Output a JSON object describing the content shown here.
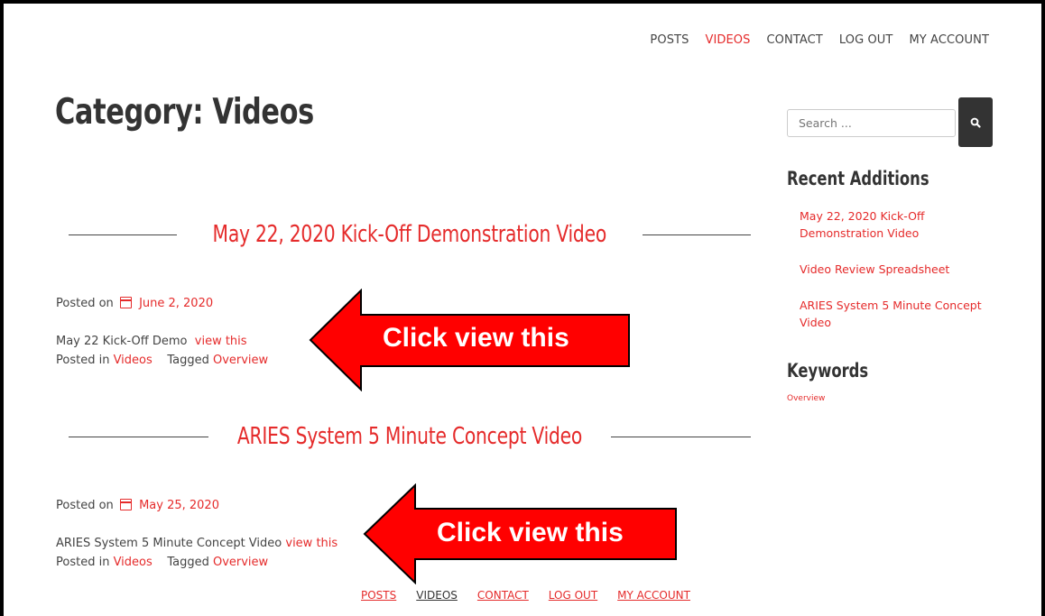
{
  "nav": {
    "items": [
      {
        "label": "POSTS"
      },
      {
        "label": "VIDEOS"
      },
      {
        "label": "CONTACT"
      },
      {
        "label": "LOG OUT"
      },
      {
        "label": "MY ACCOUNT"
      }
    ],
    "active": "VIDEOS"
  },
  "page_title": "Category: Videos",
  "posts": [
    {
      "title": "May 22, 2020 Kick-Off Demonstration Video",
      "posted_on_label": "Posted on",
      "date": "June 2, 2020",
      "excerpt": "May 22 Kick-Off Demo",
      "view_link": "view this",
      "posted_in_label": "Posted in",
      "category": "Videos",
      "tagged_label": "Tagged",
      "tag": "Overview"
    },
    {
      "title": "ARIES System 5 Minute Concept Video",
      "posted_on_label": "Posted on",
      "date": "May 25, 2020",
      "excerpt": "ARIES System 5 Minute Concept Video",
      "view_link": "view this",
      "posted_in_label": "Posted in",
      "category": "Videos",
      "tagged_label": "Tagged",
      "tag": "Overview"
    }
  ],
  "annotations": [
    {
      "label": "Click view this"
    },
    {
      "label": "Click view this"
    }
  ],
  "sidebar": {
    "search_placeholder": "Search ...",
    "search_icon": "search-icon",
    "recent_heading": "Recent Additions",
    "recent": [
      {
        "label": "May 22, 2020 Kick-Off Demonstration Video"
      },
      {
        "label": "Video Review Spreadsheet"
      },
      {
        "label": "ARIES System 5 Minute Concept Video"
      }
    ],
    "keywords_heading": "Keywords",
    "keywords": [
      {
        "label": "Overview"
      }
    ]
  },
  "footer_nav": {
    "items": [
      {
        "label": "POSTS"
      },
      {
        "label": "VIDEOS"
      },
      {
        "label": "CONTACT"
      },
      {
        "label": "LOG OUT"
      },
      {
        "label": "MY ACCOUNT"
      }
    ]
  },
  "colors": {
    "accent": "#e52b2b",
    "text": "#333333",
    "arrow": "#ff0000"
  }
}
